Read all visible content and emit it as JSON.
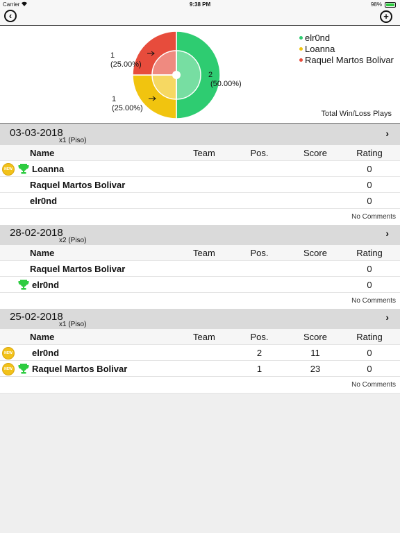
{
  "status_bar": {
    "carrier": "Carrier",
    "time": "9:38 PM",
    "battery": "98%"
  },
  "nav": {
    "back_icon": "back-icon",
    "add_icon": "add-icon"
  },
  "chart_data": {
    "type": "pie",
    "title": "Total Win/Loss Plays",
    "series": [
      {
        "name": "elr0nd",
        "value": 2,
        "label": "2\n(50.00%)",
        "percent": 50.0,
        "color": "#2ecc71"
      },
      {
        "name": "Loanna",
        "value": 1,
        "label": "1\n(25.00%)",
        "percent": 25.0,
        "color": "#f1c40f"
      },
      {
        "name": "Raquel Martos Bolivar",
        "value": 1,
        "label": "1\n(25.00%)",
        "percent": 25.0,
        "color": "#e74c3c"
      }
    ],
    "slice_labels": {
      "green": {
        "value": "2",
        "pct": "(50.00%)"
      },
      "yellow": {
        "value": "1",
        "pct": "(25.00%)"
      },
      "red": {
        "value": "1",
        "pct": "(25.00%)"
      }
    },
    "legend_position": "top-right"
  },
  "legend": [
    {
      "label": "elr0nd",
      "color": "#2ecc71"
    },
    {
      "label": "Loanna",
      "color": "#f1c40f"
    },
    {
      "label": "Raquel Martos Bolivar",
      "color": "#e74c3c"
    }
  ],
  "columns": {
    "name": "Name",
    "team": "Team",
    "pos": "Pos.",
    "score": "Score",
    "rating": "Rating"
  },
  "badge_text": "NEW",
  "sessions": [
    {
      "date": "03-03-2018",
      "sub": "x1 (Piso)",
      "comments": "No Comments",
      "players": [
        {
          "name": "Loanna",
          "new": true,
          "winner": true,
          "team": "",
          "pos": "",
          "score": "",
          "rating": "0"
        },
        {
          "name": "Raquel Martos Bolivar",
          "new": false,
          "winner": false,
          "team": "",
          "pos": "",
          "score": "",
          "rating": "0"
        },
        {
          "name": "elr0nd",
          "new": false,
          "winner": false,
          "team": "",
          "pos": "",
          "score": "",
          "rating": "0"
        }
      ]
    },
    {
      "date": "28-02-2018",
      "sub": "x2 (Piso)",
      "comments": "No Comments",
      "players": [
        {
          "name": "Raquel Martos Bolivar",
          "new": false,
          "winner": false,
          "team": "",
          "pos": "",
          "score": "",
          "rating": "0"
        },
        {
          "name": "elr0nd",
          "new": false,
          "winner": true,
          "team": "",
          "pos": "",
          "score": "",
          "rating": "0"
        }
      ]
    },
    {
      "date": "25-02-2018",
      "sub": "x1 (Piso)",
      "comments": "No Comments",
      "players": [
        {
          "name": "elr0nd",
          "new": true,
          "winner": false,
          "team": "",
          "pos": "2",
          "score": "11",
          "rating": "0"
        },
        {
          "name": "Raquel Martos Bolivar",
          "new": true,
          "winner": true,
          "team": "",
          "pos": "1",
          "score": "23",
          "rating": "0"
        }
      ]
    }
  ]
}
